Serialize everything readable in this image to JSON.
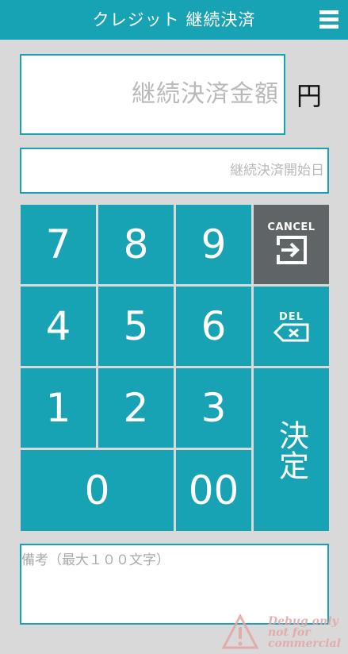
{
  "header": {
    "title": "クレジット 継続決済",
    "menu_icon": "hamburger-menu-icon"
  },
  "form": {
    "amount_placeholder": "継続決済金額",
    "currency_label": "円",
    "date_placeholder": "継続決済開始日",
    "memo_placeholder": "備考（最大１００文字）"
  },
  "keypad": {
    "row1": [
      "7",
      "8",
      "9"
    ],
    "row2": [
      "4",
      "5",
      "6"
    ],
    "row3": [
      "1",
      "2",
      "3"
    ],
    "zero": "0",
    "double_zero": "00",
    "cancel_label": "CANCEL",
    "del_label": "DEL",
    "confirm_label": "決定",
    "colors": {
      "digit_bg": "#18a3b4",
      "cancel_bg": "#5f6566"
    }
  },
  "watermark": {
    "line1": "Debug only",
    "line2": "not for",
    "line3": "commercial"
  }
}
